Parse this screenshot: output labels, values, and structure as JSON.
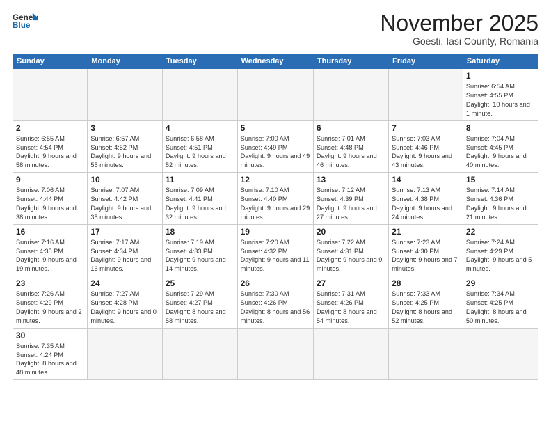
{
  "header": {
    "logo_general": "General",
    "logo_blue": "Blue",
    "month": "November 2025",
    "location": "Goesti, Iasi County, Romania"
  },
  "weekdays": [
    "Sunday",
    "Monday",
    "Tuesday",
    "Wednesday",
    "Thursday",
    "Friday",
    "Saturday"
  ],
  "weeks": [
    [
      {
        "day": "",
        "info": ""
      },
      {
        "day": "",
        "info": ""
      },
      {
        "day": "",
        "info": ""
      },
      {
        "day": "",
        "info": ""
      },
      {
        "day": "",
        "info": ""
      },
      {
        "day": "",
        "info": ""
      },
      {
        "day": "1",
        "info": "Sunrise: 6:54 AM\nSunset: 4:55 PM\nDaylight: 10 hours\nand 1 minute."
      }
    ],
    [
      {
        "day": "2",
        "info": "Sunrise: 6:55 AM\nSunset: 4:54 PM\nDaylight: 9 hours\nand 58 minutes."
      },
      {
        "day": "3",
        "info": "Sunrise: 6:57 AM\nSunset: 4:52 PM\nDaylight: 9 hours\nand 55 minutes."
      },
      {
        "day": "4",
        "info": "Sunrise: 6:58 AM\nSunset: 4:51 PM\nDaylight: 9 hours\nand 52 minutes."
      },
      {
        "day": "5",
        "info": "Sunrise: 7:00 AM\nSunset: 4:49 PM\nDaylight: 9 hours\nand 49 minutes."
      },
      {
        "day": "6",
        "info": "Sunrise: 7:01 AM\nSunset: 4:48 PM\nDaylight: 9 hours\nand 46 minutes."
      },
      {
        "day": "7",
        "info": "Sunrise: 7:03 AM\nSunset: 4:46 PM\nDaylight: 9 hours\nand 43 minutes."
      },
      {
        "day": "8",
        "info": "Sunrise: 7:04 AM\nSunset: 4:45 PM\nDaylight: 9 hours\nand 40 minutes."
      }
    ],
    [
      {
        "day": "9",
        "info": "Sunrise: 7:06 AM\nSunset: 4:44 PM\nDaylight: 9 hours\nand 38 minutes."
      },
      {
        "day": "10",
        "info": "Sunrise: 7:07 AM\nSunset: 4:42 PM\nDaylight: 9 hours\nand 35 minutes."
      },
      {
        "day": "11",
        "info": "Sunrise: 7:09 AM\nSunset: 4:41 PM\nDaylight: 9 hours\nand 32 minutes."
      },
      {
        "day": "12",
        "info": "Sunrise: 7:10 AM\nSunset: 4:40 PM\nDaylight: 9 hours\nand 29 minutes."
      },
      {
        "day": "13",
        "info": "Sunrise: 7:12 AM\nSunset: 4:39 PM\nDaylight: 9 hours\nand 27 minutes."
      },
      {
        "day": "14",
        "info": "Sunrise: 7:13 AM\nSunset: 4:38 PM\nDaylight: 9 hours\nand 24 minutes."
      },
      {
        "day": "15",
        "info": "Sunrise: 7:14 AM\nSunset: 4:36 PM\nDaylight: 9 hours\nand 21 minutes."
      }
    ],
    [
      {
        "day": "16",
        "info": "Sunrise: 7:16 AM\nSunset: 4:35 PM\nDaylight: 9 hours\nand 19 minutes."
      },
      {
        "day": "17",
        "info": "Sunrise: 7:17 AM\nSunset: 4:34 PM\nDaylight: 9 hours\nand 16 minutes."
      },
      {
        "day": "18",
        "info": "Sunrise: 7:19 AM\nSunset: 4:33 PM\nDaylight: 9 hours\nand 14 minutes."
      },
      {
        "day": "19",
        "info": "Sunrise: 7:20 AM\nSunset: 4:32 PM\nDaylight: 9 hours\nand 11 minutes."
      },
      {
        "day": "20",
        "info": "Sunrise: 7:22 AM\nSunset: 4:31 PM\nDaylight: 9 hours\nand 9 minutes."
      },
      {
        "day": "21",
        "info": "Sunrise: 7:23 AM\nSunset: 4:30 PM\nDaylight: 9 hours\nand 7 minutes."
      },
      {
        "day": "22",
        "info": "Sunrise: 7:24 AM\nSunset: 4:29 PM\nDaylight: 9 hours\nand 5 minutes."
      }
    ],
    [
      {
        "day": "23",
        "info": "Sunrise: 7:26 AM\nSunset: 4:29 PM\nDaylight: 9 hours\nand 2 minutes."
      },
      {
        "day": "24",
        "info": "Sunrise: 7:27 AM\nSunset: 4:28 PM\nDaylight: 9 hours\nand 0 minutes."
      },
      {
        "day": "25",
        "info": "Sunrise: 7:29 AM\nSunset: 4:27 PM\nDaylight: 8 hours\nand 58 minutes."
      },
      {
        "day": "26",
        "info": "Sunrise: 7:30 AM\nSunset: 4:26 PM\nDaylight: 8 hours\nand 56 minutes."
      },
      {
        "day": "27",
        "info": "Sunrise: 7:31 AM\nSunset: 4:26 PM\nDaylight: 8 hours\nand 54 minutes."
      },
      {
        "day": "28",
        "info": "Sunrise: 7:33 AM\nSunset: 4:25 PM\nDaylight: 8 hours\nand 52 minutes."
      },
      {
        "day": "29",
        "info": "Sunrise: 7:34 AM\nSunset: 4:25 PM\nDaylight: 8 hours\nand 50 minutes."
      }
    ],
    [
      {
        "day": "30",
        "info": "Sunrise: 7:35 AM\nSunset: 4:24 PM\nDaylight: 8 hours\nand 48 minutes."
      },
      {
        "day": "",
        "info": ""
      },
      {
        "day": "",
        "info": ""
      },
      {
        "day": "",
        "info": ""
      },
      {
        "day": "",
        "info": ""
      },
      {
        "day": "",
        "info": ""
      },
      {
        "day": "",
        "info": ""
      }
    ]
  ]
}
